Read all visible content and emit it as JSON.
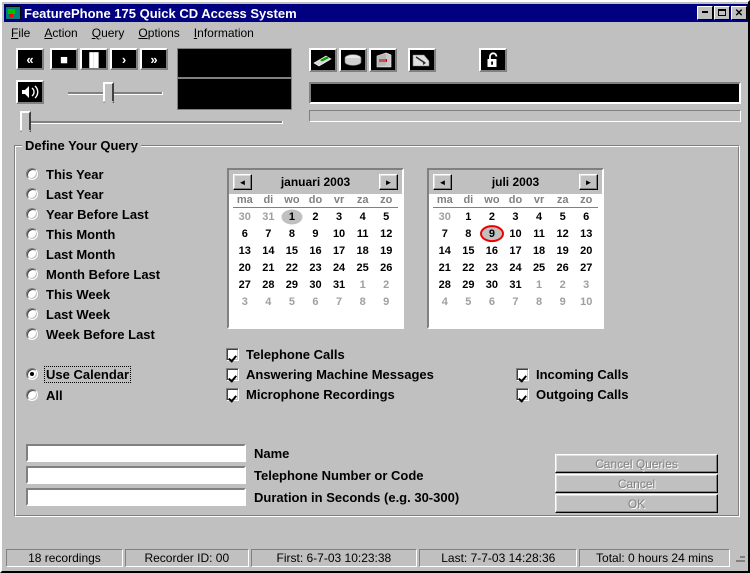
{
  "window": {
    "title": "FeaturePhone 175 Quick CD Access System",
    "icon": "app-icon",
    "buttons": {
      "minimize": "_",
      "maximize": "□",
      "close": "✕"
    }
  },
  "menubar": [
    {
      "name": "file",
      "accel": "F",
      "rest": "ile"
    },
    {
      "name": "action",
      "accel": "A",
      "rest": "ction"
    },
    {
      "name": "query",
      "accel": "Q",
      "rest": "uery"
    },
    {
      "name": "options",
      "accel": "O",
      "rest": "ptions"
    },
    {
      "name": "information",
      "accel": "I",
      "rest": "nformation"
    }
  ],
  "toolbar": {
    "transport": [
      {
        "name": "rewind-button",
        "glyph": "«"
      },
      {
        "name": "stop-button",
        "glyph": "■"
      },
      {
        "name": "pause-button",
        "glyph": "▐▌"
      },
      {
        "name": "play-button",
        "glyph": "›"
      },
      {
        "name": "fast-forward-button",
        "glyph": "»"
      }
    ],
    "volume_button": {
      "name": "volume-speaker-button",
      "glyph": "◀))"
    },
    "device_icons": [
      {
        "name": "pen-marker-icon"
      },
      {
        "name": "disc-icon"
      },
      {
        "name": "cd-tower-icon"
      },
      {
        "name": "scanner-icon"
      }
    ],
    "lock_button": {
      "name": "padlock-icon"
    }
  },
  "query_group": {
    "legend": "Define Your Query",
    "radios": [
      {
        "label": "This Year",
        "selected": false
      },
      {
        "label": "Last Year",
        "selected": false
      },
      {
        "label": "Year Before Last",
        "selected": false
      },
      {
        "label": "This Month",
        "selected": false
      },
      {
        "label": "Last Month",
        "selected": false
      },
      {
        "label": "Month Before Last",
        "selected": false
      },
      {
        "label": "This Week",
        "selected": false
      },
      {
        "label": "Last Week",
        "selected": false
      },
      {
        "label": "Week Before Last",
        "selected": false
      },
      {
        "label": "Use Calendar",
        "selected": true
      },
      {
        "label": "All",
        "selected": false
      }
    ],
    "checkboxes_left": [
      {
        "label": "Telephone Calls",
        "checked": true
      },
      {
        "label": "Answering Machine Messages",
        "checked": true
      },
      {
        "label": "Microphone Recordings",
        "checked": true
      }
    ],
    "checkboxes_right": [
      {
        "label": "Incoming Calls",
        "checked": true
      },
      {
        "label": "Outgoing Calls",
        "checked": true
      }
    ]
  },
  "calendars": [
    {
      "name": "start-calendar",
      "title": "januari 2003",
      "prev": "◄",
      "next": "►",
      "dow": [
        "ma",
        "di",
        "wo",
        "do",
        "vr",
        "za",
        "zo"
      ],
      "weeks": [
        [
          {
            "d": "30",
            "o": true
          },
          {
            "d": "31",
            "o": true
          },
          {
            "d": "1",
            "sel": true
          },
          {
            "d": "2"
          },
          {
            "d": "3"
          },
          {
            "d": "4"
          },
          {
            "d": "5"
          }
        ],
        [
          {
            "d": "6"
          },
          {
            "d": "7"
          },
          {
            "d": "8"
          },
          {
            "d": "9"
          },
          {
            "d": "10"
          },
          {
            "d": "11"
          },
          {
            "d": "12"
          }
        ],
        [
          {
            "d": "13"
          },
          {
            "d": "14"
          },
          {
            "d": "15"
          },
          {
            "d": "16"
          },
          {
            "d": "17"
          },
          {
            "d": "18"
          },
          {
            "d": "19"
          }
        ],
        [
          {
            "d": "20"
          },
          {
            "d": "21"
          },
          {
            "d": "22"
          },
          {
            "d": "23"
          },
          {
            "d": "24"
          },
          {
            "d": "25"
          },
          {
            "d": "26"
          }
        ],
        [
          {
            "d": "27"
          },
          {
            "d": "28"
          },
          {
            "d": "29"
          },
          {
            "d": "30"
          },
          {
            "d": "31"
          },
          {
            "d": "1",
            "o": true
          },
          {
            "d": "2",
            "o": true
          }
        ],
        [
          {
            "d": "3",
            "o": true
          },
          {
            "d": "4",
            "o": true
          },
          {
            "d": "5",
            "o": true
          },
          {
            "d": "6",
            "o": true
          },
          {
            "d": "7",
            "o": true
          },
          {
            "d": "8",
            "o": true
          },
          {
            "d": "9",
            "o": true
          }
        ]
      ]
    },
    {
      "name": "end-calendar",
      "title": "juli 2003",
      "prev": "◄",
      "next": "►",
      "dow": [
        "ma",
        "di",
        "wo",
        "do",
        "vr",
        "za",
        "zo"
      ],
      "weeks": [
        [
          {
            "d": "30",
            "o": true
          },
          {
            "d": "1"
          },
          {
            "d": "2"
          },
          {
            "d": "3"
          },
          {
            "d": "4"
          },
          {
            "d": "5"
          },
          {
            "d": "6"
          }
        ],
        [
          {
            "d": "7"
          },
          {
            "d": "8"
          },
          {
            "d": "9",
            "sel": true,
            "annot": true
          },
          {
            "d": "10"
          },
          {
            "d": "11"
          },
          {
            "d": "12"
          },
          {
            "d": "13"
          }
        ],
        [
          {
            "d": "14"
          },
          {
            "d": "15"
          },
          {
            "d": "16"
          },
          {
            "d": "17"
          },
          {
            "d": "18"
          },
          {
            "d": "19"
          },
          {
            "d": "20"
          }
        ],
        [
          {
            "d": "21"
          },
          {
            "d": "22"
          },
          {
            "d": "23"
          },
          {
            "d": "24"
          },
          {
            "d": "25"
          },
          {
            "d": "26"
          },
          {
            "d": "27"
          }
        ],
        [
          {
            "d": "28"
          },
          {
            "d": "29"
          },
          {
            "d": "30"
          },
          {
            "d": "31"
          },
          {
            "d": "1",
            "o": true
          },
          {
            "d": "2",
            "o": true
          },
          {
            "d": "3",
            "o": true
          }
        ],
        [
          {
            "d": "4",
            "o": true
          },
          {
            "d": "5",
            "o": true
          },
          {
            "d": "6",
            "o": true
          },
          {
            "d": "7",
            "o": true
          },
          {
            "d": "8",
            "o": true
          },
          {
            "d": "9",
            "o": true
          },
          {
            "d": "10",
            "o": true
          }
        ]
      ]
    }
  ],
  "form": {
    "fields": [
      {
        "name": "name-field",
        "value": "",
        "placeholder": "",
        "label": "Name"
      },
      {
        "name": "telephone-field",
        "value": "",
        "placeholder": "",
        "label": "Telephone Number or Code"
      },
      {
        "name": "duration-field",
        "value": "",
        "placeholder": "",
        "label": "Duration in Seconds (e.g. 30-300)"
      }
    ],
    "buttons": [
      {
        "name": "cancel-queries-button",
        "label": "Cancel Queries"
      },
      {
        "name": "cancel-button",
        "label": "Cancel"
      },
      {
        "name": "ok-button",
        "label": "OK"
      }
    ]
  },
  "statusbar": [
    {
      "name": "status-recordings",
      "text": "18 recordings"
    },
    {
      "name": "status-recorder-id",
      "text": "Recorder ID: 00"
    },
    {
      "name": "status-first",
      "text": "First:  6-7-03 10:23:38"
    },
    {
      "name": "status-last",
      "text": "Last:  7-7-03 14:28:36"
    },
    {
      "name": "status-total",
      "text": "Total: 0 hours 24 mins"
    }
  ],
  "colors": {
    "titlebar": "#000080",
    "face": "#c0c0c0",
    "annotation": "#ee0000",
    "lcd": "#000000"
  }
}
